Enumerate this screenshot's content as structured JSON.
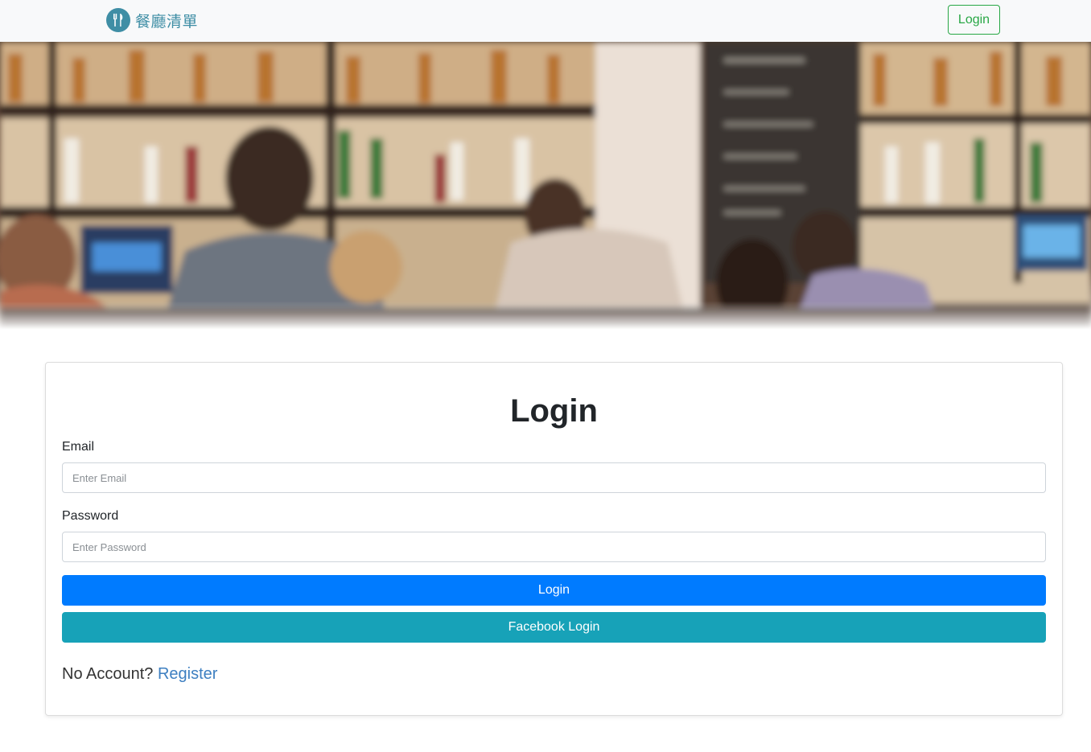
{
  "navbar": {
    "brand_text": "餐廳清單",
    "brand_icon": "fork-knife-icon",
    "login_label": "Login",
    "login_color": "#28a745",
    "brand_color": "#3f8ea5"
  },
  "hero": {
    "image": "blurred-bar-photo"
  },
  "login_form": {
    "title": "Login",
    "email_label": "Email",
    "email_placeholder": "Enter Email",
    "email_value": "",
    "password_label": "Password",
    "password_placeholder": "Enter Password",
    "password_value": "",
    "login_button_label": "Login",
    "login_button_color": "#007bff",
    "facebook_button_label": "Facebook Login",
    "facebook_button_color": "#17a2b8",
    "no_account_text": "No Account?",
    "register_link_text": "Register"
  }
}
